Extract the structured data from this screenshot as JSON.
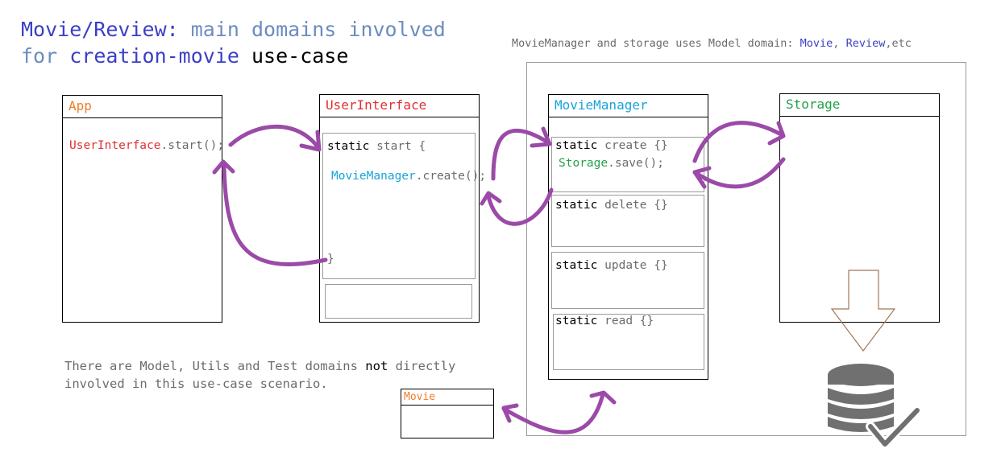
{
  "title": {
    "line1": {
      "a": "Movie/Review:",
      "b": "main domains involved"
    },
    "line2": {
      "a": "for",
      "b": "creation-movie",
      "c": "use-case"
    }
  },
  "note_top": {
    "a": "MovieManager and storage uses Model domain:",
    "b": "Movie",
    "c": ",",
    "d": "Review",
    "e": ",etc"
  },
  "note_bottom": {
    "a": "There are Model, Utils and Test domains",
    "b": "not",
    "c": "directly",
    "d": "involved in this use-case scenario."
  },
  "app": {
    "title": "App",
    "call_cls": "UserInterface",
    "call_rest": ".start();"
  },
  "ui": {
    "title": "UserInterface",
    "kw": "static",
    "start": "start {",
    "call_cls": "MovieManager",
    "call_rest": ".create();",
    "close": "}"
  },
  "mm": {
    "title": "MovieManager",
    "kw": "static",
    "m_create": "create {}",
    "m_delete": "delete {}",
    "m_update": "update {}",
    "m_read": "read {}",
    "save_cls": "Storage",
    "save_rest": ".save();"
  },
  "storage": {
    "title": "Storage"
  },
  "movie": {
    "title": "Movie"
  },
  "colors": {
    "title_blue": "#3b3fc4",
    "title_light": "#6b8cc0",
    "app_orange": "#f07c2a",
    "ui_red": "#e03030",
    "mm_cyan": "#1aa3d9",
    "storage_green": "#23a14a",
    "arrow_purple": "#9b4aa8",
    "db_gray": "#707070"
  }
}
